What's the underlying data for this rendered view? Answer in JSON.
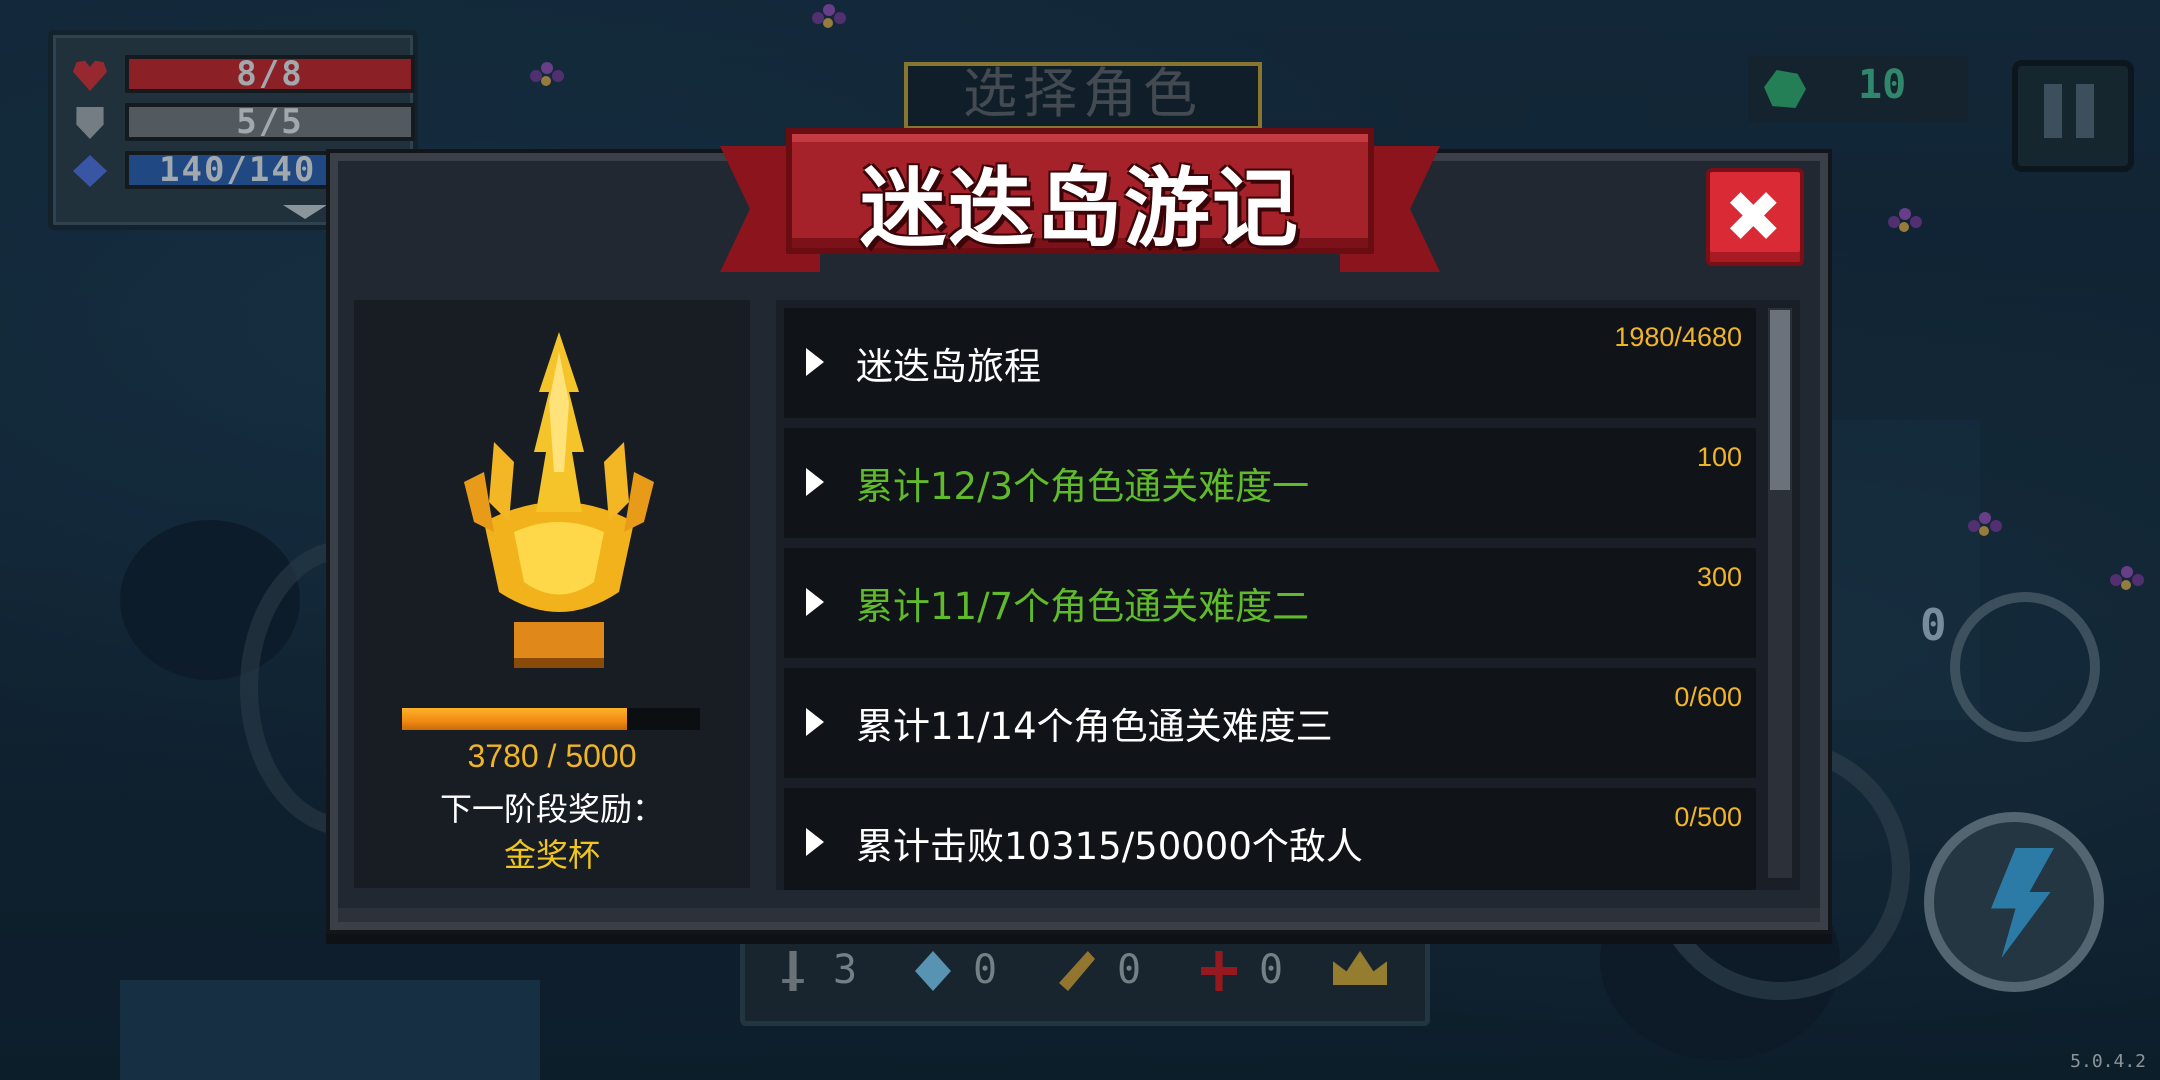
{
  "hud": {
    "hp": "8/8",
    "armor": "5/5",
    "energy": "140/140",
    "gems": "10",
    "weapon_energy": "0",
    "version": "5.0.4.2"
  },
  "background": {
    "select_title": "选择角色"
  },
  "inventory": [
    {
      "icon": "sword-icon",
      "count": "3"
    },
    {
      "icon": "diamond-icon",
      "count": "0"
    },
    {
      "icon": "feather-icon",
      "count": "0"
    },
    {
      "icon": "cross-icon",
      "count": "0"
    }
  ],
  "dialog": {
    "title": "迷迭岛游记",
    "close_symbol": "✖",
    "reward": {
      "progress_text": "3780 / 5000",
      "progress_value": 3780,
      "progress_max": 5000,
      "next_label": "下一阶段奖励：",
      "next_value": "金奖杯"
    },
    "quests": [
      {
        "label": "迷迭岛旅程",
        "reward": "1980/4680",
        "color": "#ffffff"
      },
      {
        "label": "累计12/3个角色通关难度一",
        "reward": "100",
        "color": "#5fba2c"
      },
      {
        "label": "累计11/7个角色通关难度二",
        "reward": "300",
        "color": "#5fba2c"
      },
      {
        "label": "累计11/14个角色通关难度三",
        "reward": "0/600",
        "color": "#ffffff"
      },
      {
        "label": "累计击败10315/50000个敌人",
        "reward": "0/500",
        "color": "#ffffff"
      }
    ]
  },
  "colors": {
    "banner": "#a6222b",
    "close": "#d92a36",
    "gold": "#f0b428",
    "green_text": "#5fba2c"
  }
}
